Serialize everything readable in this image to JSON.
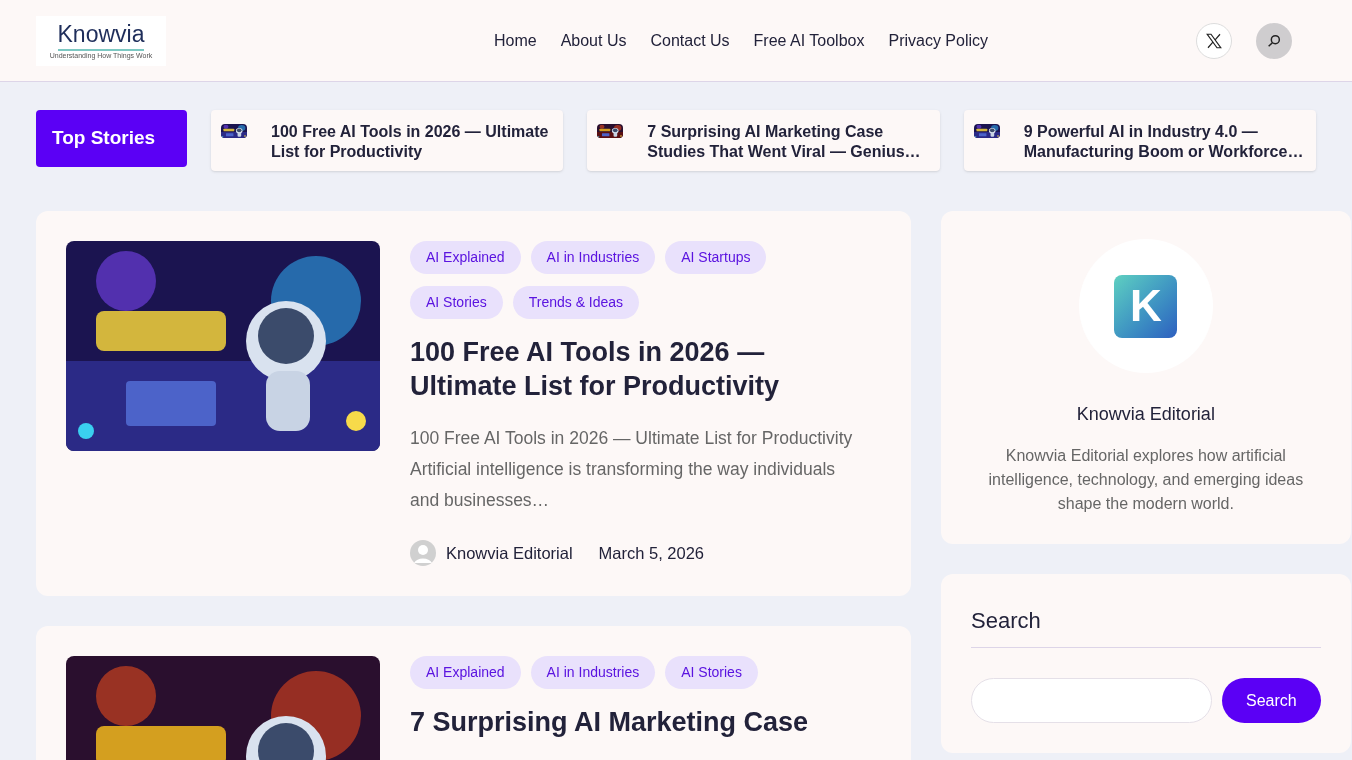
{
  "header": {
    "logo": {
      "name": "Knowvia",
      "tagline": "Understanding How Things Work"
    },
    "nav": [
      {
        "label": "Home"
      },
      {
        "label": "About Us"
      },
      {
        "label": "Contact Us"
      },
      {
        "label": "Free AI Toolbox"
      },
      {
        "label": "Privacy Policy"
      }
    ]
  },
  "top_stories": {
    "label": "Top Stories",
    "items": [
      {
        "title": "100 Free AI Tools in 2026 — Ultimate List for Productivity"
      },
      {
        "title": "7 Surprising AI Marketing Case Studies That Went Viral — Genius…"
      },
      {
        "title": "9 Powerful AI in Industry 4.0 — Manufacturing Boom or Workforce…"
      }
    ]
  },
  "posts": [
    {
      "tags": [
        "AI Explained",
        "AI in Industries",
        "AI Startups",
        "AI Stories",
        "Trends & Ideas"
      ],
      "title": "100 Free AI Tools in 2026 — Ultimate List for Productivity",
      "excerpt": "100 Free AI Tools in 2026 — Ultimate List for Productivity Artificial intelligence is transforming the way individuals and businesses…",
      "author": "Knowvia Editorial",
      "date": "March 5, 2026"
    },
    {
      "tags": [
        "AI Explained",
        "AI in Industries",
        "AI Stories"
      ],
      "title": "7 Surprising AI Marketing Case"
    }
  ],
  "sidebar": {
    "author": {
      "logo_letter": "K",
      "name": "Knowvia Editorial",
      "bio": "Knowvia Editorial explores how artificial intelligence, technology, and emerging ideas shape the modern world."
    },
    "search": {
      "title": "Search",
      "button": "Search"
    }
  }
}
